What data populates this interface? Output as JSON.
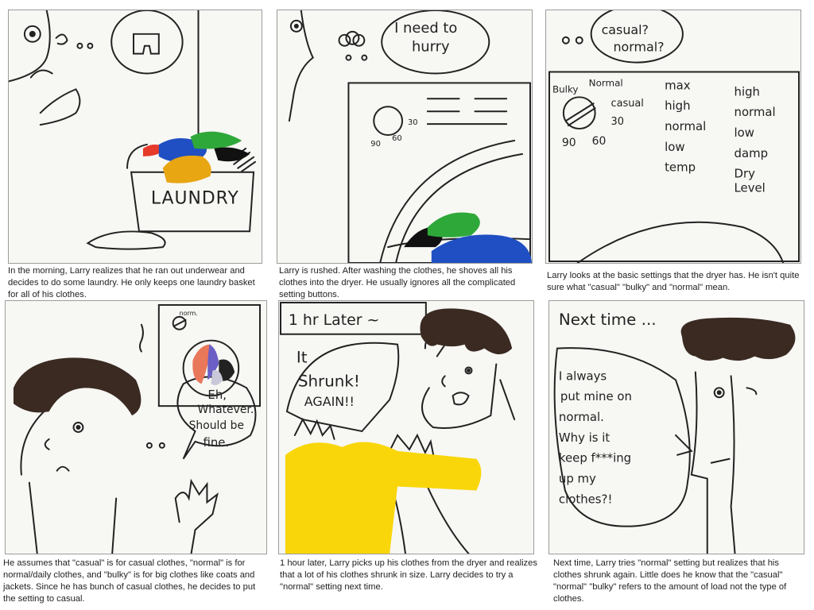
{
  "panels": [
    {
      "caption": "In the morning, Larry realizes that he ran out underwear and decides to do some laundry. He only keeps one laundry basket for all of his clothes.",
      "texts": {
        "basket": "LAUNDRY",
        "thought_dots": "o o"
      }
    },
    {
      "caption": "Larry is rushed. After washing the clothes, he shoves all his clothes into the dryer. He usually ignores all the complicated setting buttons.",
      "texts": {
        "bubble_line1": "I need to",
        "bubble_line2": "hurry",
        "dial_30": "30",
        "dial_60": "60",
        "dial_90": "90"
      }
    },
    {
      "caption": "Larry looks at the basic settings that the dryer has. He isn't quite sure what \"casual\" \"bulky\" and \"normal\" mean.",
      "texts": {
        "thought_line1": "casual?",
        "thought_line2": "normal?",
        "bulky": "Bulky",
        "normal": "Normal",
        "casual": "casual",
        "n30": "30",
        "n90": "90",
        "n60": "60",
        "col1": [
          "max",
          "high",
          "normal",
          "low",
          "temp"
        ],
        "col2": [
          "high",
          "normal",
          "low",
          "damp",
          "Dry",
          "Level"
        ]
      }
    },
    {
      "caption": "He assumes that \"casual\" is for casual clothes, \"normal\" is for normal/daily clothes, and \"bulky\" is for big clothes like coats and jackets. Since he has bunch of casual clothes, he decides to put the setting to casual.",
      "texts": {
        "dial_label": "norm.",
        "bubble_line1": "Eh,",
        "bubble_line2": "Whatever.",
        "bubble_line3": "Should be",
        "bubble_line4": "fine."
      }
    },
    {
      "caption": "1 hour later, Larry picks up his clothes from the dryer and realizes that a lot of his clothes shrunk in size. Larry decides to try a \"normal\" setting next time.",
      "texts": {
        "timebox": "1 hr Later ~",
        "bubble_line1": "It",
        "bubble_line2": "Shrunk!",
        "bubble_line3": "AGAIN!!"
      }
    },
    {
      "caption": "Next time, Larry tries \"normal\" setting but realizes that his clothes shrunk again. Little does he know that the \"casual\" \"normal\" \"bulky\" refers to the amount of load not the type of clothes.",
      "texts": {
        "heading": "Next time ...",
        "bubble_lines": [
          "I always",
          "put mine on",
          "normal.",
          "Why is it",
          "keep f***ing",
          "up my",
          "clothes?!"
        ]
      }
    }
  ],
  "colors": {
    "red": "#e63a2a",
    "blue": "#1f4fc2",
    "green": "#2fa83a",
    "black": "#111111",
    "orange": "#e8a613",
    "yellow": "#f9d60a",
    "hair": "#3a2a22"
  }
}
